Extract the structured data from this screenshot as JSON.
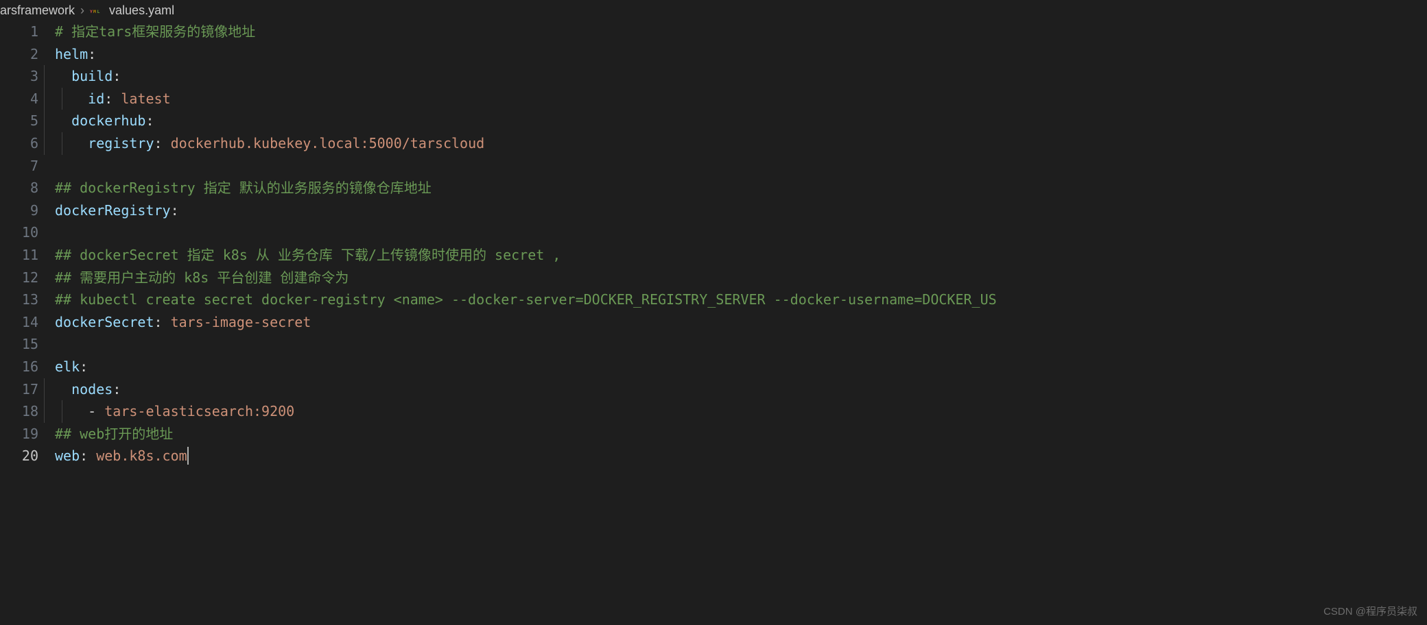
{
  "breadcrumb": {
    "folder": "arsframework",
    "file": "values.yaml",
    "icon_label": "YML"
  },
  "editor": {
    "line_start": 1,
    "line_count": 20,
    "current_line": 20,
    "lines": {
      "l1": {
        "indent": 0,
        "tokens": [
          {
            "c": "tok-comment",
            "t": "# 指定tars框架服务的镜像地址"
          }
        ],
        "guides": []
      },
      "l2": {
        "indent": 0,
        "tokens": [
          {
            "c": "tok-key",
            "t": "helm"
          },
          {
            "c": "tok-punct",
            "t": ":"
          }
        ],
        "guides": []
      },
      "l3": {
        "indent": 2,
        "tokens": [
          {
            "c": "tok-key",
            "t": "build"
          },
          {
            "c": "tok-punct",
            "t": ":"
          }
        ],
        "guides": [
          0
        ]
      },
      "l4": {
        "indent": 4,
        "tokens": [
          {
            "c": "tok-key",
            "t": "id"
          },
          {
            "c": "tok-punct",
            "t": ": "
          },
          {
            "c": "tok-string",
            "t": "latest"
          }
        ],
        "guides": [
          0,
          2
        ]
      },
      "l5": {
        "indent": 2,
        "tokens": [
          {
            "c": "tok-key",
            "t": "dockerhub"
          },
          {
            "c": "tok-punct",
            "t": ":"
          }
        ],
        "guides": [
          0
        ]
      },
      "l6": {
        "indent": 4,
        "tokens": [
          {
            "c": "tok-key",
            "t": "registry"
          },
          {
            "c": "tok-punct",
            "t": ": "
          },
          {
            "c": "tok-string",
            "t": "dockerhub.kubekey.local:5000/tarscloud"
          }
        ],
        "guides": [
          0,
          2
        ]
      },
      "l7": {
        "indent": 0,
        "tokens": [],
        "guides": []
      },
      "l8": {
        "indent": 0,
        "tokens": [
          {
            "c": "tok-comment",
            "t": "## dockerRegistry 指定 默认的业务服务的镜像仓库地址"
          }
        ],
        "guides": []
      },
      "l9": {
        "indent": 0,
        "tokens": [
          {
            "c": "tok-key",
            "t": "dockerRegistry"
          },
          {
            "c": "tok-punct",
            "t": ":"
          }
        ],
        "guides": []
      },
      "l10": {
        "indent": 0,
        "tokens": [],
        "guides": []
      },
      "l11": {
        "indent": 0,
        "tokens": [
          {
            "c": "tok-comment",
            "t": "## dockerSecret 指定 k8s 从 业务仓库 下载/上传镜像时使用的 secret ,"
          }
        ],
        "guides": []
      },
      "l12": {
        "indent": 0,
        "tokens": [
          {
            "c": "tok-comment",
            "t": "## 需要用户主动的 k8s 平台创建 创建命令为"
          }
        ],
        "guides": []
      },
      "l13": {
        "indent": 0,
        "tokens": [
          {
            "c": "tok-comment",
            "t": "## kubectl create secret docker-registry <name> --docker-server=DOCKER_REGISTRY_SERVER --docker-username=DOCKER_US"
          }
        ],
        "guides": []
      },
      "l14": {
        "indent": 0,
        "tokens": [
          {
            "c": "tok-key",
            "t": "dockerSecret"
          },
          {
            "c": "tok-punct",
            "t": ": "
          },
          {
            "c": "tok-string",
            "t": "tars-image-secret"
          }
        ],
        "guides": []
      },
      "l15": {
        "indent": 0,
        "tokens": [],
        "guides": []
      },
      "l16": {
        "indent": 0,
        "tokens": [
          {
            "c": "tok-key",
            "t": "elk"
          },
          {
            "c": "tok-punct",
            "t": ":"
          }
        ],
        "guides": []
      },
      "l17": {
        "indent": 2,
        "tokens": [
          {
            "c": "tok-key",
            "t": "nodes"
          },
          {
            "c": "tok-punct",
            "t": ":"
          }
        ],
        "guides": [
          0
        ]
      },
      "l18": {
        "indent": 4,
        "tokens": [
          {
            "c": "tok-dash",
            "t": "- "
          },
          {
            "c": "tok-string",
            "t": "tars-elasticsearch:9200"
          }
        ],
        "guides": [
          0,
          2
        ]
      },
      "l19": {
        "indent": 0,
        "tokens": [
          {
            "c": "tok-comment",
            "t": "## web打开的地址"
          }
        ],
        "guides": []
      },
      "l20": {
        "indent": 0,
        "tokens": [
          {
            "c": "tok-key",
            "t": "web"
          },
          {
            "c": "tok-punct",
            "t": ": "
          },
          {
            "c": "tok-string",
            "t": "web.k8s.com"
          }
        ],
        "guides": [],
        "cursor_after": true
      }
    }
  },
  "watermark": "CSDN @程序员柒叔"
}
